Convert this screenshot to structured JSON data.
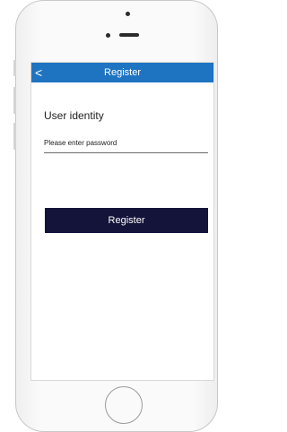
{
  "navbar": {
    "back_icon": "chevron-left-icon",
    "back_glyph": "<",
    "title": "Register",
    "color": "#1f74c1"
  },
  "form": {
    "heading": "User identity",
    "password_placeholder": "Please enter password",
    "password_value": "",
    "submit_label": "Register",
    "submit_color": "#14143a"
  }
}
